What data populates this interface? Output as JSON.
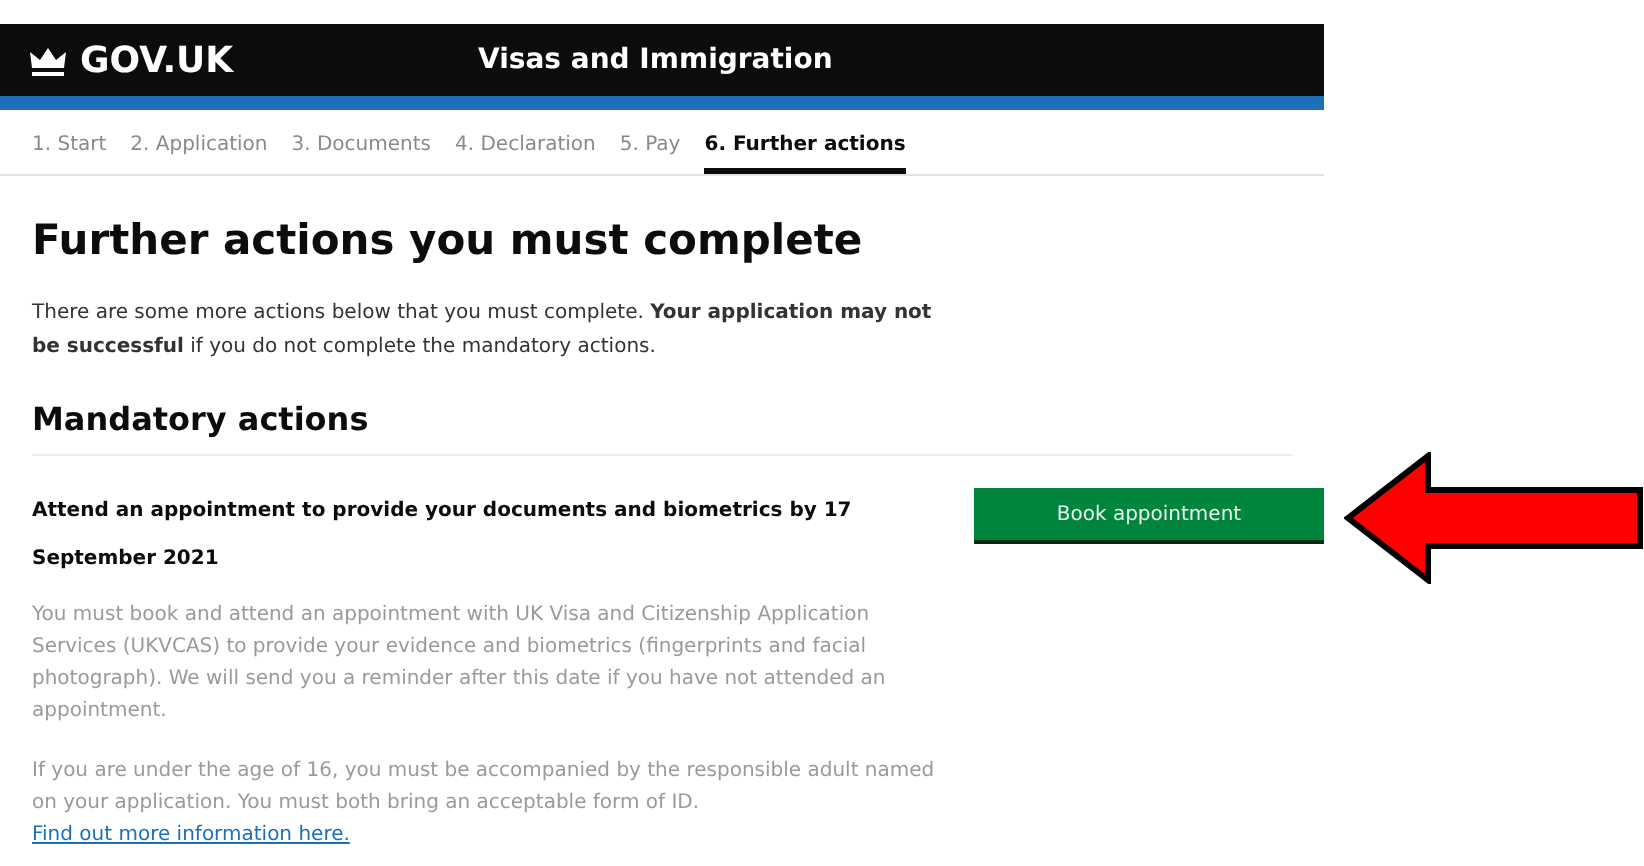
{
  "header": {
    "logo": "GOV.UK",
    "service": "Visas and Immigration"
  },
  "steps": [
    {
      "label": "1. Start",
      "selected": false
    },
    {
      "label": "2. Application",
      "selected": false
    },
    {
      "label": "3. Documents",
      "selected": false
    },
    {
      "label": "4. Declaration",
      "selected": false
    },
    {
      "label": "5. Pay",
      "selected": false
    },
    {
      "label": "6. Further actions",
      "selected": true
    }
  ],
  "title": "Further actions you must complete",
  "intro": "There are some more actions below that you must complete. **Your application may not be successful** if you do not complete the mandatory actions.",
  "section_heading": "Mandatory actions",
  "action": {
    "title": "Attend an appointment to provide your documents and biometrics by 17 September 2021",
    "button": "Book appointment",
    "paragraphs": [
      "You must book and attend an appointment with UK Visa and Citizenship Application Services (UKVCAS) to provide your evidence and biometrics (fingerprints and facial photograph). We will send you a reminder after this date if you have not attended an appointment.",
      "If you are under the age of 16, you must be accompanied by the responsible adult named on your application. You must both bring an acceptable form of ID."
    ],
    "link": "Find out more information here."
  }
}
